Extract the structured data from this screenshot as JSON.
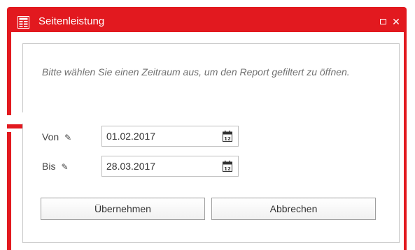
{
  "window": {
    "title": "Seitenleistung",
    "maximize_label": "",
    "close_label": "✕"
  },
  "dialog": {
    "message": "Bitte wählen Sie einen Zeitraum aus, um den Report gefiltert zu öffnen.",
    "from": {
      "label": "Von",
      "value": "01.02.2017"
    },
    "to": {
      "label": "Bis",
      "value": "28.03.2017"
    },
    "buttons": {
      "apply": "Übernehmen",
      "cancel": "Abbrechen"
    }
  },
  "colors": {
    "accent": "#e2191f"
  },
  "icons": {
    "app": "table-icon",
    "edit": "pencil-icon",
    "calendar": "calendar-icon"
  }
}
